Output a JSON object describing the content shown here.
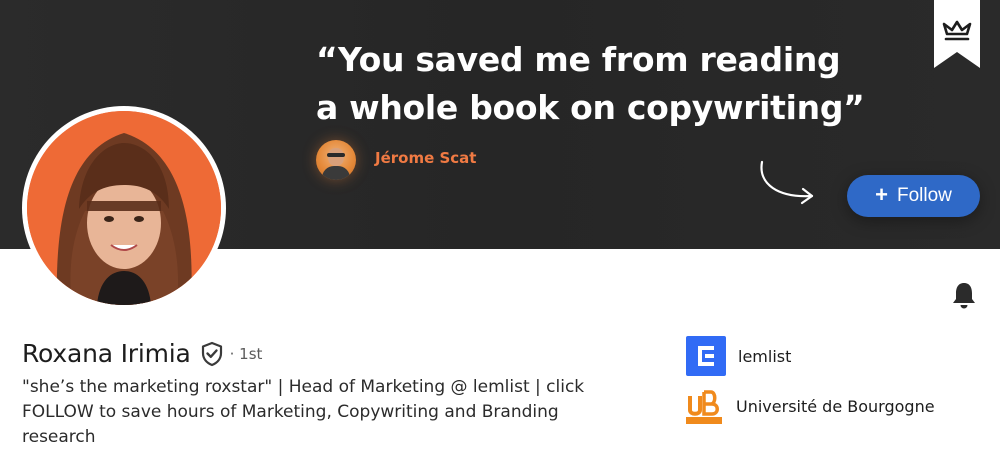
{
  "banner": {
    "quote_line1": "“You saved me from reading",
    "quote_line2": "a whole book on copywriting”",
    "author_name": "Jérome Scat",
    "follow_label": "Follow",
    "colors": {
      "background": "#262626",
      "author_accent": "#f07a43",
      "follow_button": "#2f69c7"
    }
  },
  "profile": {
    "name": "Roxana Irimia",
    "degree": "· 1st",
    "headline": "\"she’s the marketing roxstar\" | Head of Marketing @ lemlist | click FOLLOW to save hours of Marketing, Copywriting and Branding research"
  },
  "organizations": [
    {
      "name": "lemlist",
      "logo_text": "E",
      "color": "#316bf5"
    },
    {
      "name": "Université de Bourgogne",
      "logo_text": "uB",
      "color": "#f08a1c"
    }
  ],
  "icons": {
    "bookmark": "crown-bookmark-icon",
    "bell": "notification-bell-icon",
    "verified": "shield-check-icon",
    "plus": "plus-icon",
    "arrow": "curved-arrow-icon"
  }
}
